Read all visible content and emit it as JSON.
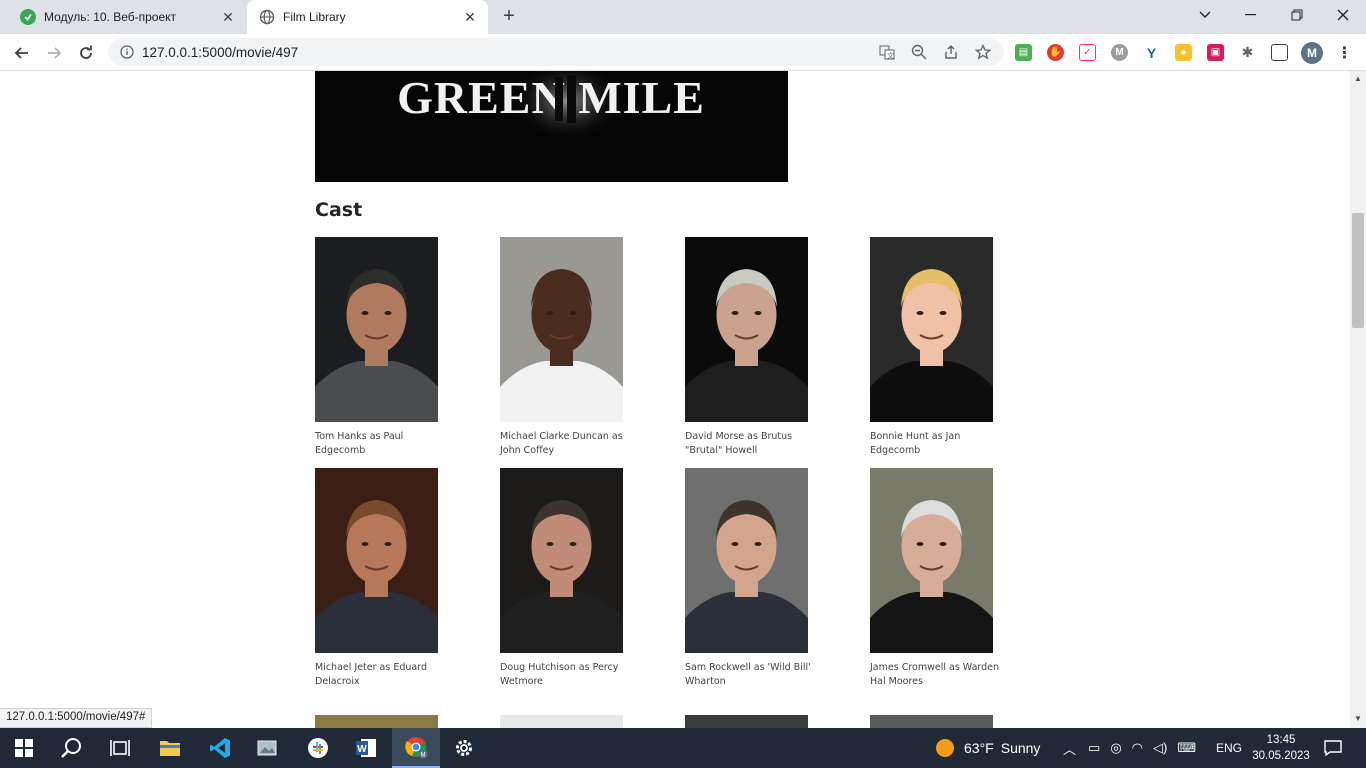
{
  "browser": {
    "tabs": [
      {
        "title": "Модуль: 10. Веб-проект",
        "icon": "moodle-green-icon",
        "active": false
      },
      {
        "title": "Film Library",
        "icon": "globe-icon",
        "active": true
      }
    ],
    "url": "127.0.0.1:5000/movie/497",
    "status_url": "127.0.0.1:5000/movie/497#"
  },
  "page": {
    "poster_title": "GREEN MILE",
    "cast_heading": "Cast",
    "cast": [
      {
        "caption": "Tom Hanks as Paul Edgecomb",
        "bg": "#1b1d20",
        "skin": "#b07a5e",
        "hair": "#2f2d2b",
        "shirt": "#4a4c50"
      },
      {
        "caption": "Michael Clarke Duncan as John Coffey",
        "bg": "#9a9892",
        "skin": "#4a2c1e",
        "hair": "#4a2c1e",
        "shirt": "#f2f2f2"
      },
      {
        "caption": "David Morse as Brutus \"Brutal\" Howell",
        "bg": "#0b0b0b",
        "skin": "#caa28e",
        "hair": "#c9c9c3",
        "shirt": "#1e1e1e"
      },
      {
        "caption": "Bonnie Hunt as Jan Edgecomb",
        "bg": "#2a2a2a",
        "skin": "#efc2a8",
        "hair": "#e2c06a",
        "shirt": "#0d0d0d"
      },
      {
        "caption": "Michael Jeter as Eduard Delacroix",
        "bg": "#3b1e14",
        "skin": "#b77759",
        "hair": "#7a4a2c",
        "shirt": "#2b2f3a"
      },
      {
        "caption": "Doug Hutchison as Percy Wetmore",
        "bg": "#1d1b1a",
        "skin": "#c08c78",
        "hair": "#3b3330",
        "shirt": "#1f1f1f"
      },
      {
        "caption": "Sam Rockwell as 'Wild Bill' Wharton",
        "bg": "#6f6f6f",
        "skin": "#d4a58d",
        "hair": "#3f342b",
        "shirt": "#2a2f3a"
      },
      {
        "caption": "James Cromwell as Warden Hal Moores",
        "bg": "#7a7a6a",
        "skin": "#d8ad98",
        "hair": "#dcdcdc",
        "shirt": "#151515"
      }
    ]
  },
  "taskbar": {
    "weather_temp": "63°F",
    "weather_text": "Sunny",
    "lang": "ENG",
    "time": "13:45",
    "date": "30.05.2023"
  }
}
